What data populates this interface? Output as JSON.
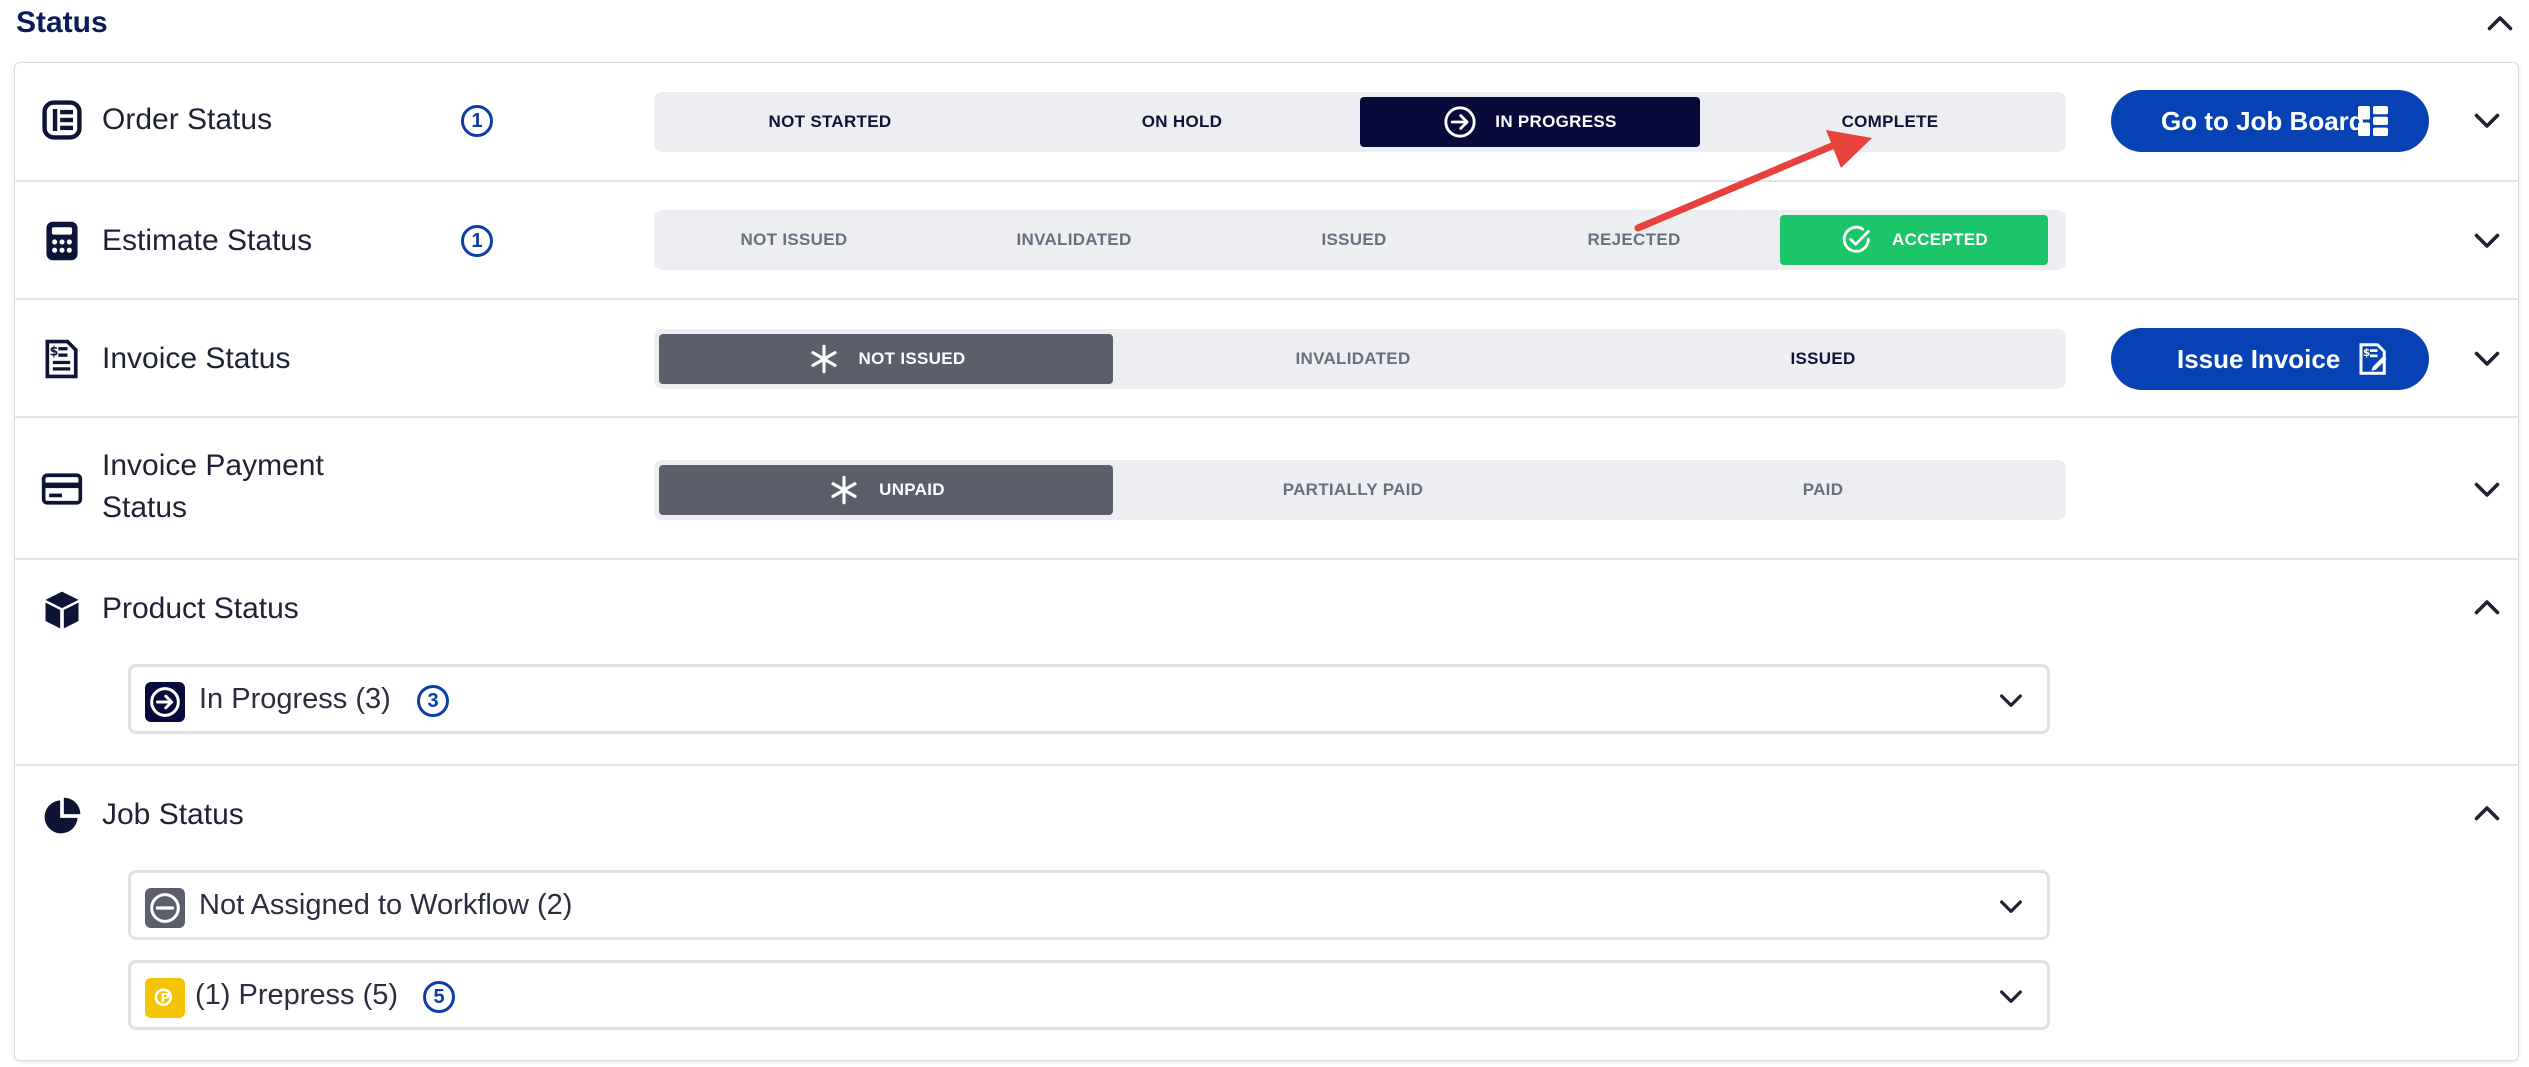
{
  "section": {
    "title": "Status"
  },
  "order_status": {
    "title": "Order Status",
    "badge": "1",
    "steps": [
      "NOT STARTED",
      "ON HOLD",
      "IN PROGRESS",
      "COMPLETE"
    ],
    "active_step": "IN PROGRESS",
    "button_label": "Go to Job Board"
  },
  "estimate_status": {
    "title": "Estimate Status",
    "badge": "1",
    "steps": [
      "NOT ISSUED",
      "INVALIDATED",
      "ISSUED",
      "REJECTED",
      "ACCEPTED"
    ],
    "active_step": "ACCEPTED"
  },
  "invoice_status": {
    "title": "Invoice Status",
    "steps": [
      "NOT ISSUED",
      "INVALIDATED",
      "ISSUED"
    ],
    "active_step": "NOT ISSUED",
    "button_label": "Issue Invoice"
  },
  "invoice_payment_status": {
    "title_line1": "Invoice Payment",
    "title_line2": "Status",
    "steps": [
      "UNPAID",
      "PARTIALLY PAID",
      "PAID"
    ],
    "active_step": "UNPAID"
  },
  "product_status": {
    "title": "Product Status",
    "items": [
      {
        "label": "In Progress (3)",
        "badge": "3"
      }
    ]
  },
  "job_status": {
    "title": "Job Status",
    "items": [
      {
        "label": "Not Assigned to Workflow (2)"
      },
      {
        "label": "(1) Prepress (5)",
        "badge": "5",
        "icon_text": "P"
      }
    ]
  },
  "colors": {
    "navy": "#070a3a",
    "primary_blue": "#0742b4",
    "accepted_green": "#1cc46a",
    "active_gray": "#5b5f6b",
    "prepress_yellow": "#f5c400",
    "annotation_red": "#e8403a"
  },
  "icons": {
    "order": "order-list-icon",
    "estimate": "calculator-icon",
    "invoice": "invoice-receipt-icon",
    "payment": "credit-card-icon",
    "product": "cube-icon",
    "job": "pie-chart-icon",
    "job_board": "grid-board-icon",
    "issue_invoice": "invoice-issue-icon"
  }
}
